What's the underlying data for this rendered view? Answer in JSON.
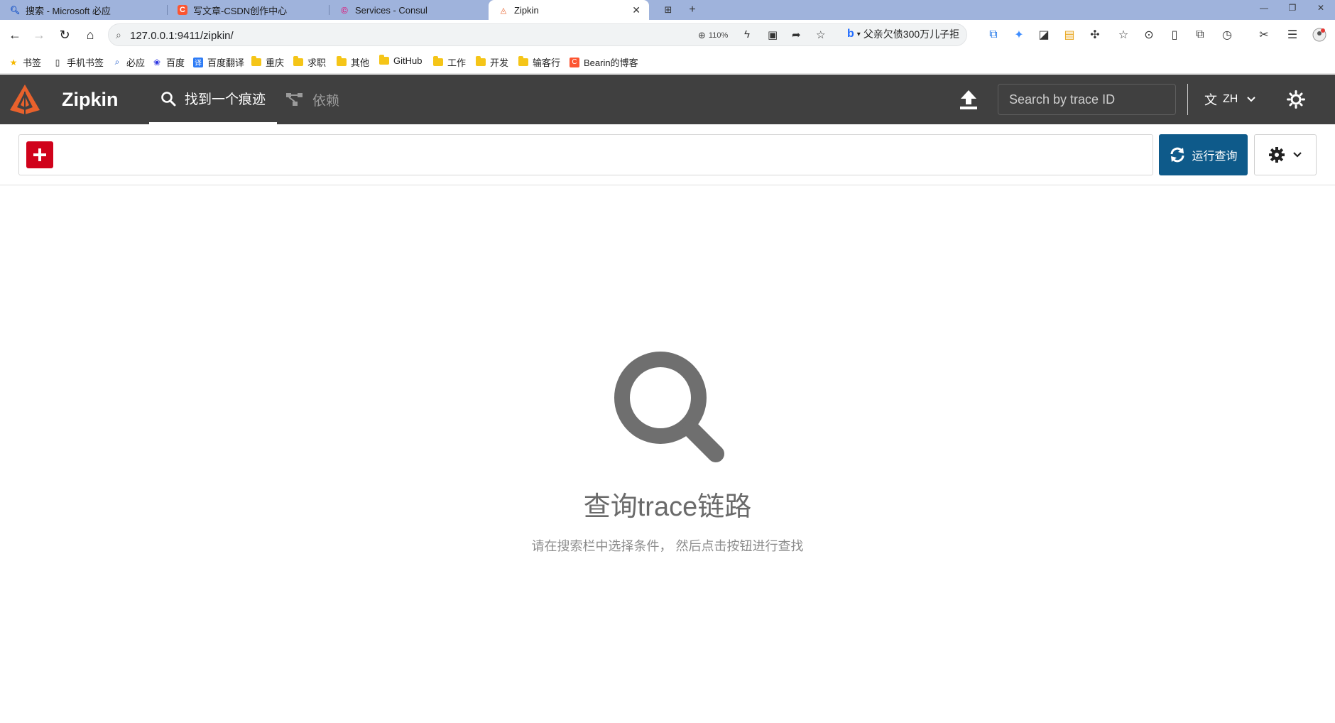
{
  "browser": {
    "tabs": [
      {
        "title": "搜索 - Microsoft 必应",
        "icon": "search-icon"
      },
      {
        "title": "写文章-CSDN创作中心",
        "icon": "csdn-icon"
      },
      {
        "title": "Services - Consul",
        "icon": "consul-icon"
      },
      {
        "title": "Zipkin",
        "icon": "zipkin-icon",
        "active": true
      }
    ],
    "url": "127.0.0.1:9411/zipkin/",
    "zoom": "110%",
    "bing_text": "父亲欠债300万儿子拒",
    "bookmarks": [
      {
        "label": "书签",
        "icon": "star-icon"
      },
      {
        "label": "手机书签",
        "icon": "phone-icon"
      },
      {
        "label": "必应",
        "icon": "search-icon"
      },
      {
        "label": "百度",
        "icon": "baidu-icon"
      },
      {
        "label": "百度翻译",
        "icon": "translate-icon"
      },
      {
        "label": "重庆",
        "icon": "folder-icon"
      },
      {
        "label": "求职",
        "icon": "folder-icon"
      },
      {
        "label": "其他",
        "icon": "folder-icon"
      },
      {
        "label": "GitHub",
        "icon": "folder-icon"
      },
      {
        "label": "工作",
        "icon": "folder-icon"
      },
      {
        "label": "开发",
        "icon": "folder-icon"
      },
      {
        "label": "输客行",
        "icon": "folder-icon"
      },
      {
        "label": "Bearin的博客",
        "icon": "csdn-icon"
      }
    ]
  },
  "header": {
    "brand": "Zipkin",
    "nav": [
      {
        "label": "找到一个痕迹",
        "icon": "search-icon",
        "active": true
      },
      {
        "label": "依赖",
        "icon": "dependency-icon",
        "active": false
      }
    ],
    "search_placeholder": "Search by trace ID",
    "language": "ZH"
  },
  "query": {
    "run_label": "运行查询"
  },
  "empty_state": {
    "title": "查询trace链路",
    "subtitle": "请在搜索栏中选择条件， 然后点击按钮进行查找"
  },
  "colors": {
    "header_bg": "#404040",
    "accent_blue": "#0e5a8a",
    "add_red": "#d0021b",
    "logo_orange": "#e8612c"
  }
}
